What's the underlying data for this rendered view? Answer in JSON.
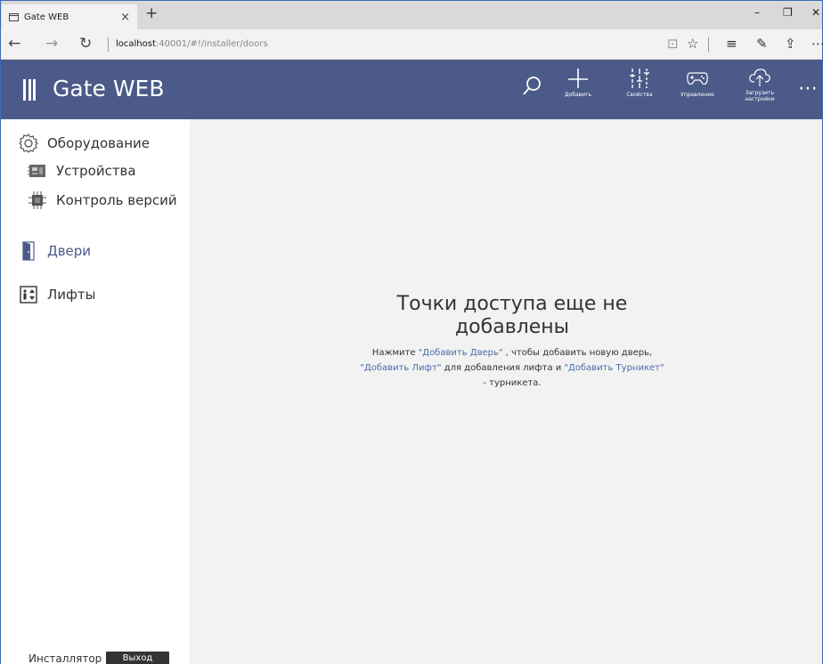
{
  "browser": {
    "tab_title": "Gate WEB",
    "tab_close": "×",
    "new_tab": "+",
    "url_host": "localhost",
    "url_rest": ":40001/#!/installer/doors",
    "controls": {
      "minimize": "–",
      "restore": "❐",
      "close": "✕"
    },
    "toolbar": {
      "back": "←",
      "forward": "→",
      "refresh": "↻",
      "reading": "⊡",
      "favorite": "☆",
      "hub": "≡",
      "notes": "✎",
      "share": "⇪",
      "more": "⋯"
    }
  },
  "app": {
    "title": "Gate WEB",
    "actions": [
      {
        "label": "Добавить",
        "icon": "plus-icon"
      },
      {
        "label": "Свойства",
        "icon": "sliders-icon"
      },
      {
        "label": "Управление",
        "icon": "gamepad-icon"
      },
      {
        "label": "Загрузить\nнастройки",
        "icon": "cloud-upload-icon"
      }
    ],
    "more": "⋯"
  },
  "sidebar": {
    "items": [
      {
        "label": "Оборудование",
        "icon": "gear-icon"
      },
      {
        "label": "Устройства",
        "icon": "board-icon"
      },
      {
        "label": "Контроль версий",
        "icon": "chip-icon"
      },
      {
        "label": "Двери",
        "icon": "door-icon"
      },
      {
        "label": "Лифты",
        "icon": "elevator-icon"
      }
    ],
    "user_role": "Инсталлятор",
    "logout_label": "Выход"
  },
  "main": {
    "empty_title_line1": "Точки доступа еще не",
    "empty_title_line2": "добавлены",
    "desc_part1": "Нажмите ",
    "link_door": "\"Добавить Дверь\"",
    "desc_part2": " , чтобы добавить новую дверь,",
    "link_lift": "\"Добавить Лифт\"",
    "desc_part3": " для добавления лифта и ",
    "link_turnstile": "\"Добавить Турникет\"",
    "desc_part4": "- турникета."
  }
}
